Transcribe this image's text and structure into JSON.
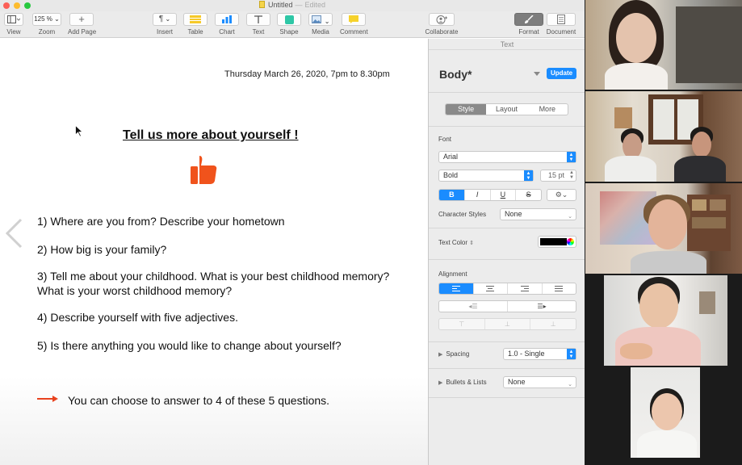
{
  "window": {
    "title": "Untitled",
    "separator": "—",
    "status": "Edited"
  },
  "toolbar": {
    "view": "View",
    "zoom_value": "125 %",
    "zoom": "Zoom",
    "add_page": "Add Page",
    "insert": "Insert",
    "table": "Table",
    "chart": "Chart",
    "text": "Text",
    "shape": "Shape",
    "media": "Media",
    "comment": "Comment",
    "collaborate": "Collaborate",
    "format": "Format",
    "document": "Document"
  },
  "document": {
    "date_line": "Thursday March 26, 2020, 7pm to 8.30pm",
    "heading": "Tell us more about yourself !",
    "questions": [
      "1) Where are you from? Describe your hometown",
      "2) How big is your family?",
      "3) Tell me about your childhood. What is your best childhood memory? What is your worst childhood memory?",
      "4) Describe yourself with five adjectives.",
      "5) Is there anything you would like to change about yourself?"
    ],
    "note": "You can choose to answer to 4 of these 5 questions."
  },
  "inspector": {
    "header": "Text",
    "style_name": "Body*",
    "update": "Update",
    "tabs": [
      "Style",
      "Layout",
      "More"
    ],
    "font_label": "Font",
    "font_family": "Arial",
    "font_weight": "Bold",
    "font_size": "15 pt",
    "bius": [
      "B",
      "I",
      "U",
      "S"
    ],
    "gear": "⚙︎⌄",
    "char_styles_label": "Character Styles",
    "char_styles_value": "None",
    "text_color_label": "Text Color",
    "alignment_label": "Alignment",
    "spacing_label": "Spacing",
    "spacing_value": "1.0 - Single",
    "bullets_label": "Bullets & Lists",
    "bullets_value": "None"
  },
  "colors": {
    "accent": "#1a8cff",
    "thumb": "#f0531c",
    "arrow": "#e8421e"
  }
}
